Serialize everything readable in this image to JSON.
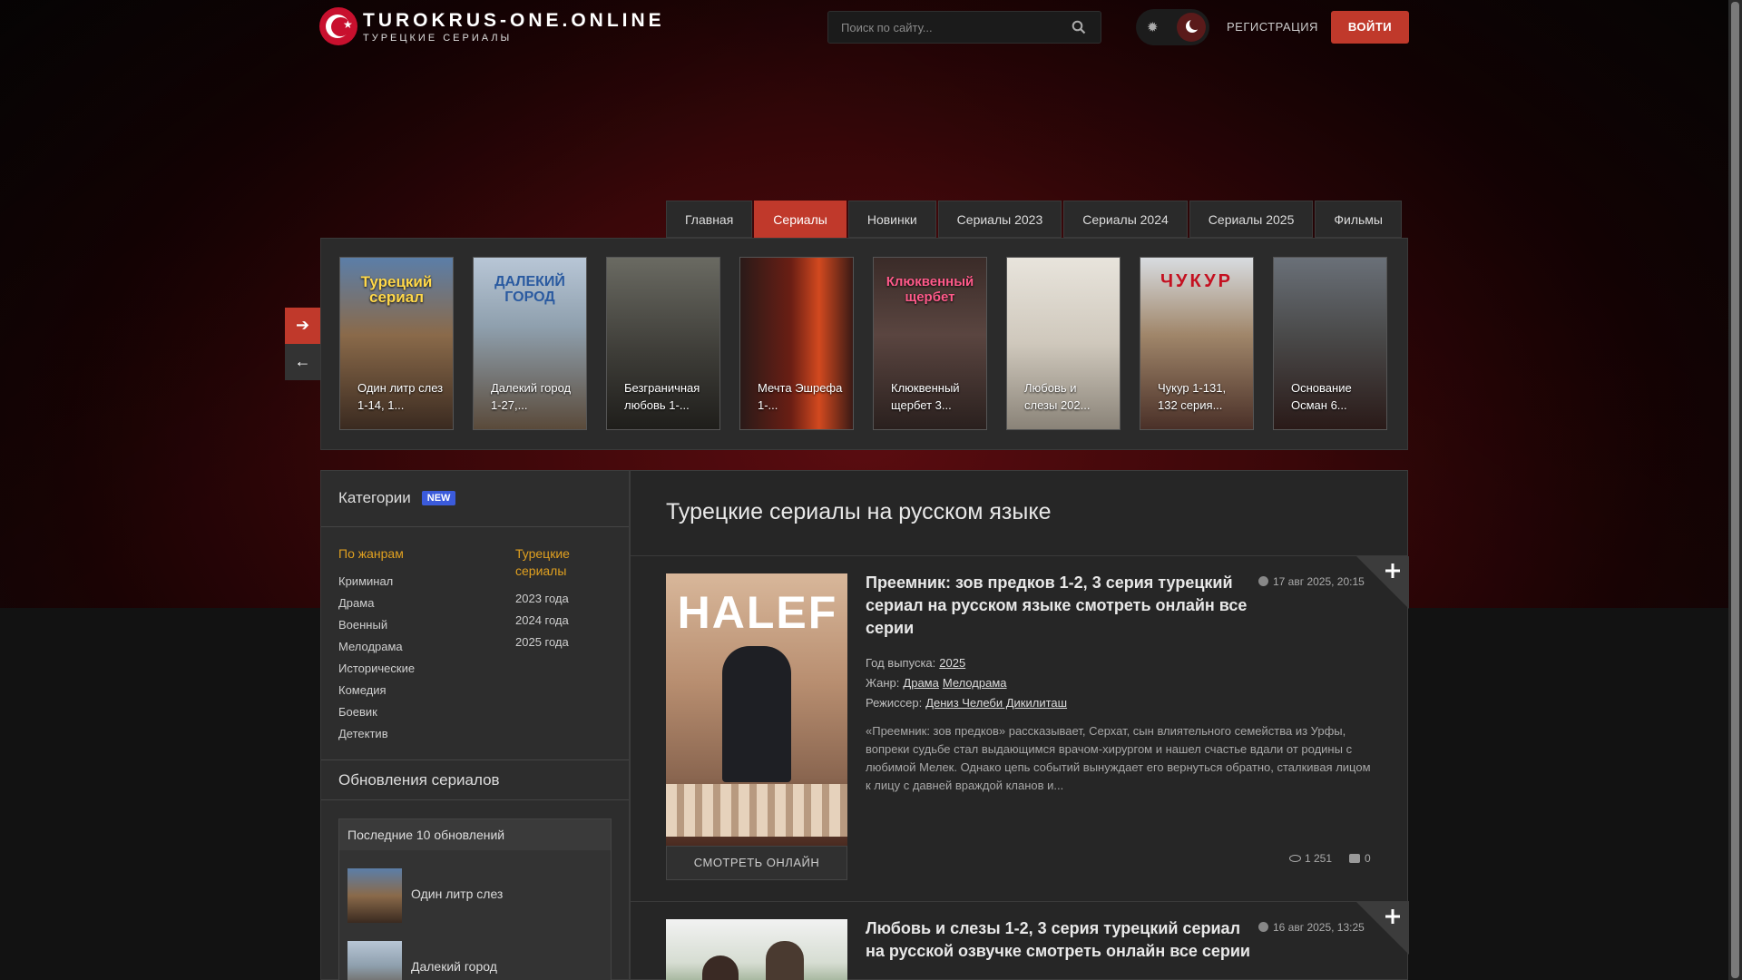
{
  "header": {
    "site_title": "TUROKRUS-ONE.ONLINE",
    "site_subtitle": "ТУРЕЦКИЕ СЕРИАЛЫ",
    "search_placeholder": "Поиск по сайту...",
    "register_label": "РЕГИСТРАЦИЯ",
    "login_label": "ВОЙТИ",
    "logo_icon": "turkish-flag-icon",
    "search_icon": "search-icon",
    "theme_icons": [
      "sun-icon",
      "moon-icon"
    ]
  },
  "nav": {
    "tabs": [
      {
        "label": "Главная"
      },
      {
        "label": "Сериалы"
      },
      {
        "label": "Новинки"
      },
      {
        "label": "Сериалы 2023"
      },
      {
        "label": "Сериалы 2024"
      },
      {
        "label": "Сериалы 2025"
      },
      {
        "label": "Фильмы"
      }
    ],
    "active_tab": "Сериалы"
  },
  "carousel": {
    "items": [
      {
        "title": "Один литр слез 1-14, 1...",
        "poster_text": "Турецкий сериал"
      },
      {
        "title": "Далекий город 1-27,...",
        "poster_text": "ДАЛЕКИЙ ГОРОД"
      },
      {
        "title": "Безграничная любовь 1-...",
        "poster_text": ""
      },
      {
        "title": "Мечта Эшрефа 1-...",
        "poster_text": ""
      },
      {
        "title": "Клюквенный щербет 3...",
        "poster_text": "Клюквенный щербет"
      },
      {
        "title": "Любовь и слезы 202...",
        "poster_text": ""
      },
      {
        "title": "Чукур 1-131, 132 серия...",
        "poster_text": "ЧУКУР"
      },
      {
        "title": "Основание Осман 6...",
        "poster_text": ""
      }
    ],
    "next_icon": "arrow-right-icon",
    "prev_icon": "arrow-left-icon"
  },
  "sidebar": {
    "categories_title": "Категории",
    "new_badge": "NEW",
    "genres_head": "По жанрам",
    "genres": [
      "Криминал",
      "Драма",
      "Военный",
      "Мелодрама",
      "Исторические",
      "Комедия",
      "Боевик",
      "Детектив"
    ],
    "turkish_head": "Турецкие сериалы",
    "years": [
      "2023 года",
      "2024 года",
      "2025 года"
    ],
    "updates_title": "Обновления сериалов",
    "last_updates_title": "Последние 10 обновлений",
    "updates": [
      {
        "label": "Один литр слез"
      },
      {
        "label": "Далекий город"
      }
    ]
  },
  "main": {
    "title": "Турецкие сериалы на русском языке",
    "posts": [
      {
        "title": "Преемник: зов предков 1-2, 3 серия турецкий сериал на русском языке смотреть онлайн все серии",
        "date": "17 авг 2025, 20:15",
        "poster_text": "HALEF",
        "year_label": "Год выпуска:",
        "year": "2025",
        "genre_label": "Жанр:",
        "genres": [
          "Драма",
          "Мелодрама"
        ],
        "director_label": "Режиссер:",
        "director": "Дениз Челеби Дикилиташ",
        "description": "«Преемник: зов предков» рассказывает, Серхат, сын влиятельного семейства из Урфы, вопреки судьбе стал выдающимся врачом-хирургом и нашел счастье вдали от родины с любимой Мелек. Однако цепь событий вынуждает его вернуться обратно, сталкивая лицом к лицу с давней враждой кланов и...",
        "watch_label": "СМОТРЕТЬ ОНЛАЙН",
        "views": "1 251",
        "comments": "0"
      },
      {
        "title": "Любовь и слезы 1-2, 3 серия турецкий сериал на русской озвучке смотреть онлайн все серии",
        "date": "16 авг 2025, 13:25"
      }
    ],
    "accent_color": "#c0392b"
  }
}
